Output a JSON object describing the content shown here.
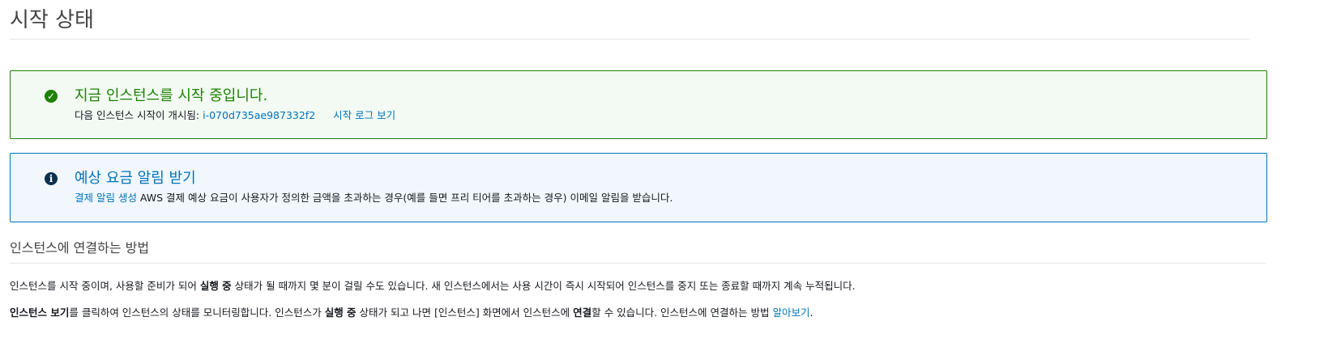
{
  "page": {
    "title": "시작 상태"
  },
  "success_alert": {
    "title": "지금 인스턴스를 시작 중입니다.",
    "body_prefix": "다음 인스턴스 시작이 개시됨: ",
    "instance_id": "i-070d735ae987332f2",
    "log_link": "시작 로그 보기",
    "color": "#1d8102"
  },
  "info_alert": {
    "title": "예상 요금 알림 받기",
    "link": "결제 알림 생성",
    "body": " AWS 결제 예상 요금이 사용자가 정의한 금액을 초과하는 경우(예를 들면 프리 티어를 초과하는 경우) 이메일 알림을 받습니다.",
    "color": "#0073bb"
  },
  "connect_section": {
    "heading": "인스턴스에 연결하는 방법",
    "para1": {
      "t1": "인스턴스를 시작 중이며, 사용할 준비가 되어 ",
      "b1": "실행 중",
      "t2": " 상태가 될 때까지 몇 분이 걸릴 수도 있습니다. 새 인스턴스에서는 사용 시간이 즉시 시작되어 인스턴스를 중지 또는 종료할 때까지 계속 누적됩니다."
    },
    "para2": {
      "b1": "인스턴스 보기",
      "t1": "를 클릭하여 인스턴스의 상태를 모니터링합니다. 인스턴스가 ",
      "b2": "실행 중",
      "t2": " 상태가 되고 나면 [인스턴스] 화면에서 인스턴스에 ",
      "b3": "연결",
      "t3": "할 수 있습니다. 인스턴스에 연결하는 방법 ",
      "link": "알아보기",
      "t4": "."
    }
  }
}
